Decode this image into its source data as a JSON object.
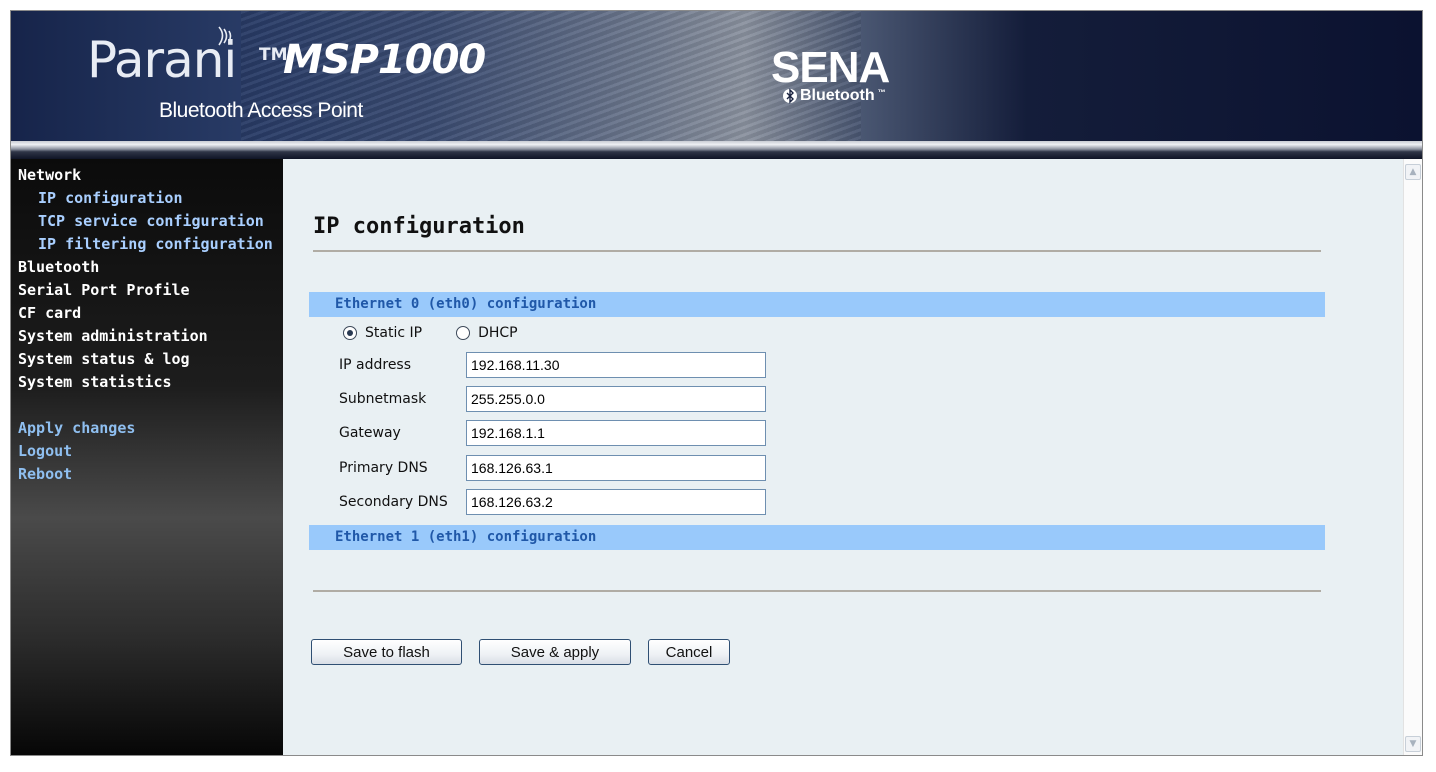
{
  "banner": {
    "product_name": "Parani",
    "trademark": "TM",
    "model": "MSP1000",
    "subtitle": "Bluetooth Access Point",
    "brand": "SENA",
    "bluetooth_label": "Bluetooth",
    "bluetooth_trademark": "™"
  },
  "sidebar": {
    "items": [
      {
        "label": "Network",
        "kind": "section"
      },
      {
        "label": "IP configuration",
        "kind": "sub"
      },
      {
        "label": "TCP service configuration",
        "kind": "sub"
      },
      {
        "label": "IP filtering configuration",
        "kind": "sub"
      },
      {
        "label": "Bluetooth",
        "kind": "section"
      },
      {
        "label": "Serial Port Profile",
        "kind": "section"
      },
      {
        "label": "CF card",
        "kind": "section"
      },
      {
        "label": "System administration",
        "kind": "section"
      },
      {
        "label": "System status & log",
        "kind": "section"
      },
      {
        "label": "System statistics",
        "kind": "section"
      }
    ],
    "actions": [
      {
        "label": "Apply changes"
      },
      {
        "label": "Logout"
      },
      {
        "label": "Reboot"
      }
    ]
  },
  "main": {
    "title": "IP configuration",
    "eth0_header": "Ethernet 0 (eth0) configuration",
    "eth1_header": "Ethernet 1 (eth1) configuration",
    "mode": {
      "options": [
        "Static IP",
        "DHCP"
      ],
      "selected": "Static IP"
    },
    "fields": [
      {
        "label": "IP address",
        "value": "192.168.11.30"
      },
      {
        "label": "Subnetmask",
        "value": "255.255.0.0"
      },
      {
        "label": "Gateway",
        "value": "192.168.1.1"
      },
      {
        "label": "Primary DNS",
        "value": "168.126.63.1"
      },
      {
        "label": "Secondary DNS",
        "value": "168.126.63.2"
      }
    ],
    "buttons": {
      "save_flash": "Save to flash",
      "save_apply": "Save & apply",
      "cancel": "Cancel"
    }
  },
  "colors": {
    "section_bar": "#99c9fb",
    "section_text": "#2058a8",
    "sub_link": "#a9cfff",
    "content_bg": "#e9f0f3"
  }
}
